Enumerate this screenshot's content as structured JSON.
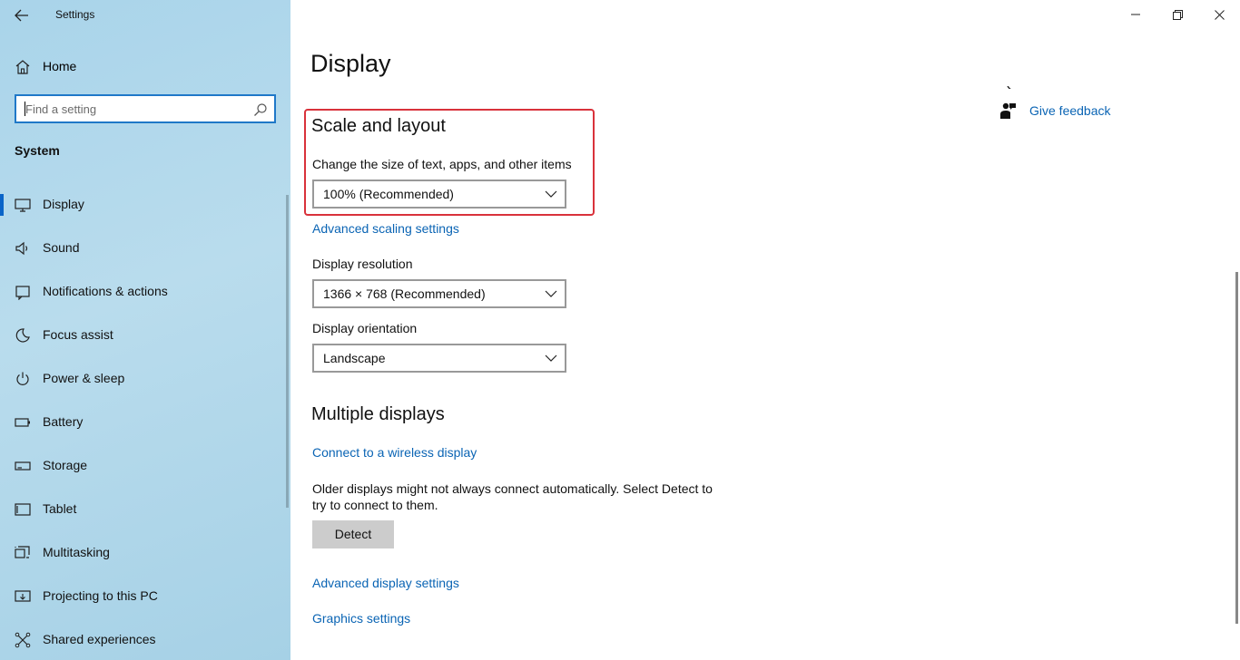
{
  "window": {
    "title": "Settings"
  },
  "sidebar": {
    "home_label": "Home",
    "search_placeholder": "Find a setting",
    "section_label": "System",
    "items": [
      {
        "label": "Display",
        "icon": "monitor-icon",
        "active": true
      },
      {
        "label": "Sound",
        "icon": "speaker-icon"
      },
      {
        "label": "Notifications & actions",
        "icon": "notification-icon"
      },
      {
        "label": "Focus assist",
        "icon": "moon-icon"
      },
      {
        "label": "Power & sleep",
        "icon": "power-icon"
      },
      {
        "label": "Battery",
        "icon": "battery-icon"
      },
      {
        "label": "Storage",
        "icon": "storage-icon"
      },
      {
        "label": "Tablet",
        "icon": "tablet-icon"
      },
      {
        "label": "Multitasking",
        "icon": "multitasking-icon"
      },
      {
        "label": "Projecting to this PC",
        "icon": "projecting-icon"
      },
      {
        "label": "Shared experiences",
        "icon": "shared-experiences-icon"
      }
    ]
  },
  "main": {
    "page_title": "Display",
    "scale_layout": {
      "heading": "Scale and layout",
      "size_label": "Change the size of text, apps, and other items",
      "size_value": "100% (Recommended)",
      "advanced_scaling_link": "Advanced scaling settings"
    },
    "resolution": {
      "label": "Display resolution",
      "value": "1366 × 768 (Recommended)"
    },
    "orientation": {
      "label": "Display orientation",
      "value": "Landscape"
    },
    "multiple_displays": {
      "heading": "Multiple displays",
      "wireless_link": "Connect to a wireless display",
      "description": "Older displays might not always connect automatically. Select Detect to try to connect to them.",
      "detect_button": "Detect",
      "advanced_display_link": "Advanced display settings",
      "graphics_link": "Graphics settings"
    },
    "related": {
      "feedback_link": "Give feedback"
    }
  },
  "colors": {
    "accent": "#0a64c8",
    "link": "#0a64b4",
    "highlight_border": "#d9323b",
    "sidebar_bg": "#b0d8ec"
  }
}
